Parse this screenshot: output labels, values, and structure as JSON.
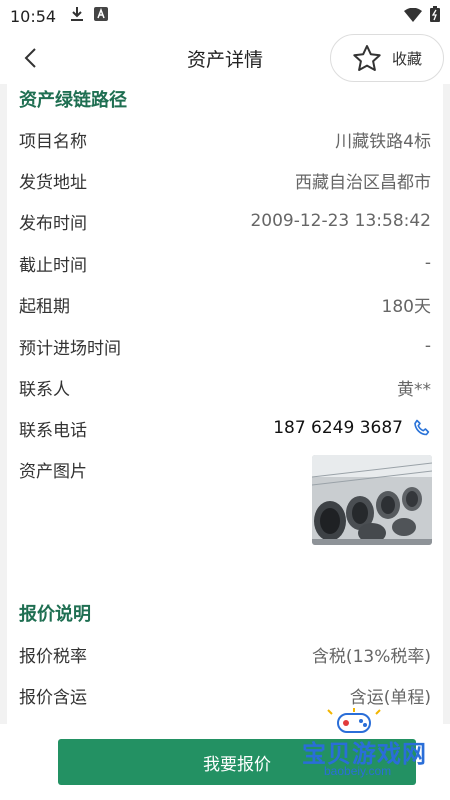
{
  "status_bar": {
    "time": "10:54",
    "icons": [
      "download-icon",
      "a-box-icon",
      "wifi-icon",
      "battery-icon"
    ]
  },
  "nav": {
    "title": "资产详情",
    "favorite_label": "收藏"
  },
  "asset_section": {
    "title": "资产绿链路径",
    "rows": [
      {
        "label": "项目名称",
        "value": "川藏铁路4标"
      },
      {
        "label": "发货地址",
        "value": "西藏自治区昌都市"
      },
      {
        "label": "发布时间",
        "value": "2009-12-23 13:58:42"
      },
      {
        "label": "截止时间",
        "value": "-"
      },
      {
        "label": "起租期",
        "value": "180天"
      },
      {
        "label": "预计进场时间",
        "value": "-"
      },
      {
        "label": "联系人",
        "value": "黄**"
      },
      {
        "label": "联系电话",
        "value": "187 6249 3687"
      },
      {
        "label": "资产图片",
        "value": ""
      }
    ]
  },
  "quote_section": {
    "title": "报价说明",
    "rows": [
      {
        "label": "报价税率",
        "value": "含税(13%税率)"
      },
      {
        "label": "报价含运",
        "value": "含运(单程)"
      }
    ]
  },
  "bottom": {
    "quote_button": "我要报价"
  },
  "watermark": {
    "text": "宝贝游戏网",
    "url": "baobeiy.com"
  }
}
